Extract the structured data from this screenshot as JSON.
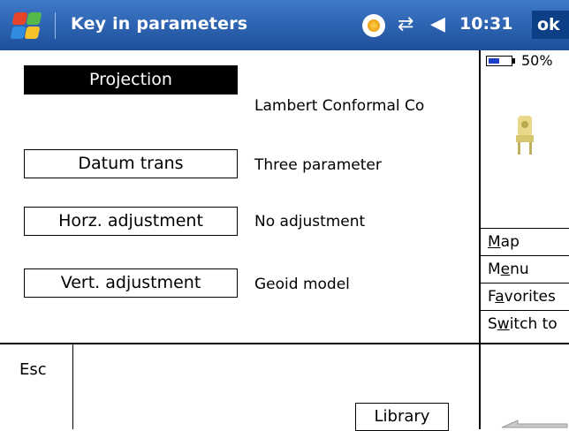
{
  "titlebar": {
    "title": "Key in parameters",
    "time": "10:31",
    "ok_label": "ok",
    "icons": [
      "windows-start-icon",
      "sync-icon",
      "connectivity-icon",
      "volume-icon"
    ]
  },
  "parameters": [
    {
      "button": "Projection",
      "value": "Lambert Conformal Co",
      "selected": true
    },
    {
      "button": "Datum trans",
      "value": "Three parameter",
      "selected": false
    },
    {
      "button": "Horz. adjustment",
      "value": "No adjustment",
      "selected": false
    },
    {
      "button": "Vert. adjustment",
      "value": "Geoid model",
      "selected": false
    }
  ],
  "status": {
    "battery_text": "50%",
    "battery_level": 0.5,
    "instrument_icon": "total-station-icon"
  },
  "side_menu": [
    {
      "pre": "",
      "key": "M",
      "post": "ap"
    },
    {
      "pre": "M",
      "key": "e",
      "post": "nu"
    },
    {
      "pre": "F",
      "key": "a",
      "post": "vorites"
    },
    {
      "pre": "S",
      "key": "w",
      "post": "itch to"
    }
  ],
  "footer": {
    "esc_label": "Esc",
    "library_label": "Library"
  },
  "colors": {
    "titlebar": "#2a62b4",
    "selected_button": "#000000",
    "battery_fill": "#1d3fc8"
  }
}
